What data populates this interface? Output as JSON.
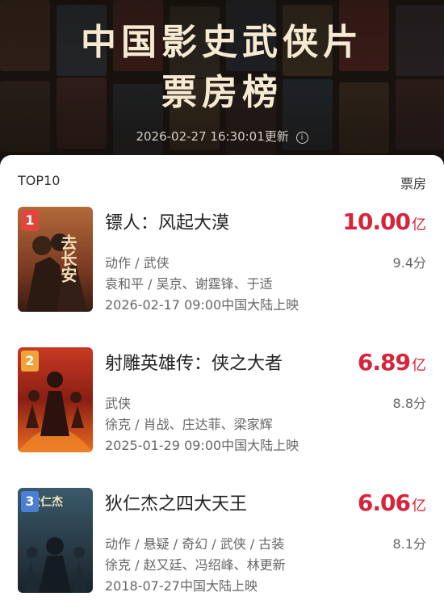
{
  "header": {
    "title_line1": "中国影史武侠片",
    "title_line2": "票房榜",
    "updated": "2026-02-27 16:30:01更新",
    "info_icon": "ⓘ"
  },
  "list": {
    "label_left": "TOP10",
    "label_right": "票房",
    "items": [
      {
        "rank": "1",
        "title": "镖人：风起大漠",
        "gross": "10.00",
        "unit": "亿",
        "genres": "动作 / 武侠",
        "score": "9.4分",
        "cast": "袁和平 / 吴京、谢霆锋、于适",
        "release": "2026-02-17 09:00中国大陆上映",
        "rank_color": "#e0463c",
        "poster_text": "去长安"
      },
      {
        "rank": "2",
        "title": "射雕英雄传：侠之大者",
        "gross": "6.89",
        "unit": "亿",
        "genres": "武侠",
        "score": "8.8分",
        "cast": "徐克 / 肖战、庄达菲、梁家辉",
        "release": "2025-01-29 09:00中国大陆上映",
        "rank_color": "#f0a33a",
        "poster_text": ""
      },
      {
        "rank": "3",
        "title": "狄仁杰之四大天王",
        "gross": "6.06",
        "unit": "亿",
        "genres": "动作 / 悬疑 / 奇幻 / 武侠 / 古装",
        "score": "8.1分",
        "cast": "徐克 / 赵又廷、冯绍峰、林更新",
        "release": "2018-07-27中国大陆上映",
        "rank_color": "#4a7fd6",
        "poster_text": "狄仁杰"
      }
    ]
  }
}
